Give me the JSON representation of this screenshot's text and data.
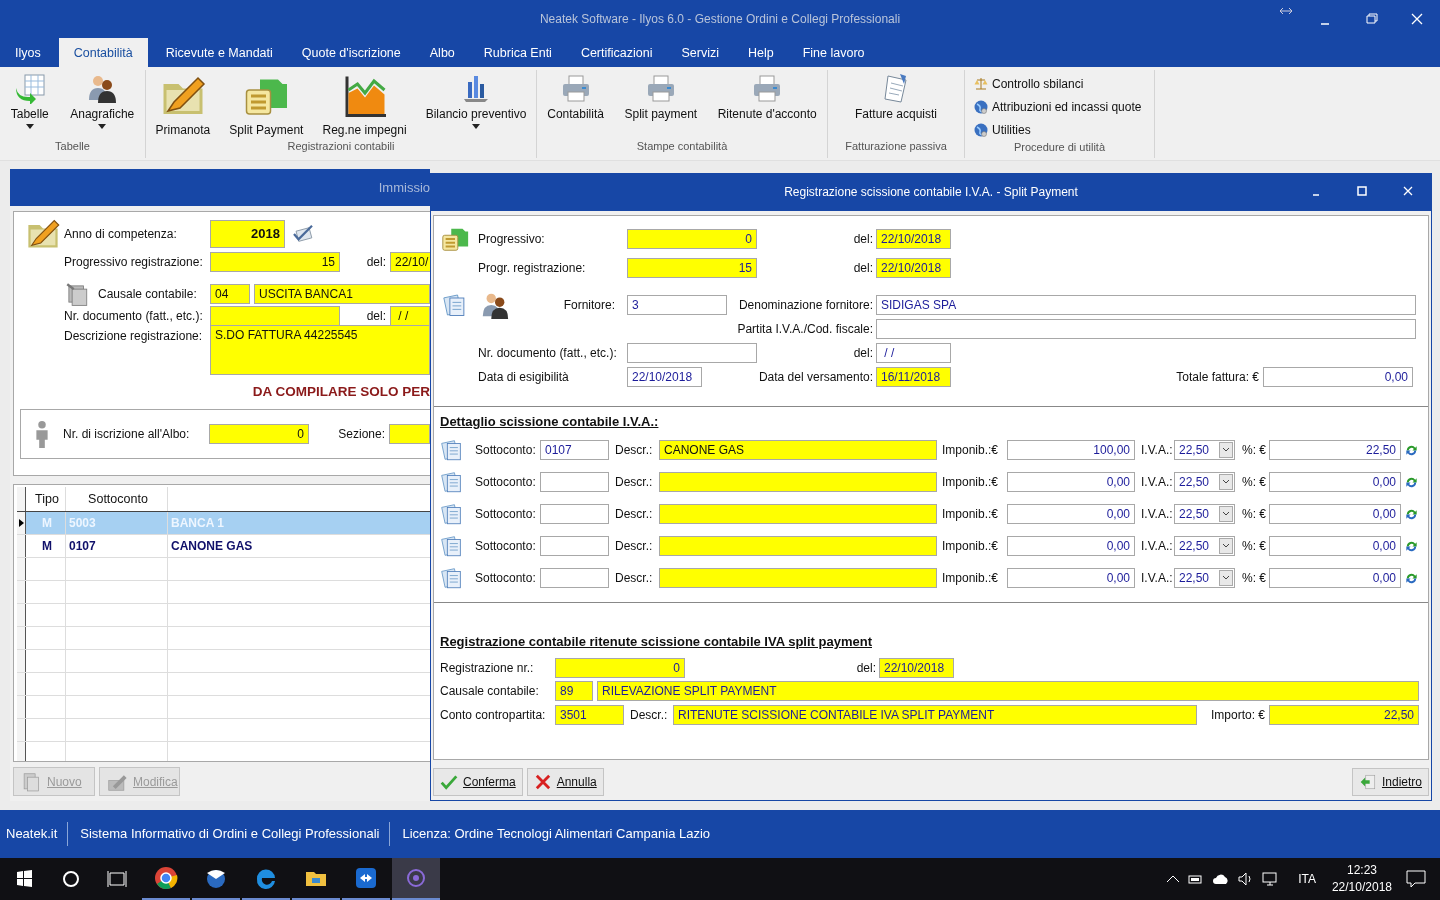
{
  "window": {
    "title": "Neatek Software - Ilyos 6.0 - Gestione Ordini e Collegi Professionali"
  },
  "menu_tabs": [
    {
      "label": "Ilyos",
      "selected": false
    },
    {
      "label": "Contabilità",
      "selected": true
    },
    {
      "label": "Ricevute e Mandati",
      "selected": false
    },
    {
      "label": "Quote d'iscrizione",
      "selected": false
    },
    {
      "label": "Albo",
      "selected": false
    },
    {
      "label": "Rubrica Enti",
      "selected": false
    },
    {
      "label": "Certificazioni",
      "selected": false
    },
    {
      "label": "Servizi",
      "selected": false
    },
    {
      "label": "Help",
      "selected": false
    },
    {
      "label": "Fine lavoro",
      "selected": false
    }
  ],
  "ribbon_groups": [
    {
      "label": "Tabelle",
      "items": [
        {
          "label": "Tabelle",
          "kind": "dropdown"
        },
        {
          "label": "Anagrafiche",
          "kind": "dropdown"
        }
      ]
    },
    {
      "label": "Registrazioni contabili",
      "items": [
        {
          "label": "Primanota",
          "kind": "large"
        },
        {
          "label": "Split Payment",
          "kind": "large"
        },
        {
          "label": "Reg.ne impegni",
          "kind": "large"
        },
        {
          "label": "Bilancio preventivo",
          "kind": "dropdown"
        }
      ]
    },
    {
      "label": "Stampe contabilità",
      "items": [
        {
          "label": "Contabilità",
          "kind": "large"
        },
        {
          "label": "Split payment",
          "kind": "large"
        },
        {
          "label": "Ritenute d'acconto",
          "kind": "large"
        }
      ]
    },
    {
      "label": "Fatturazione passiva",
      "items": [
        {
          "label": "Fatture acquisti",
          "kind": "large"
        }
      ]
    },
    {
      "label": "Procedure di utilità",
      "items": [
        {
          "label": "Controllo sbilanci",
          "kind": "small"
        },
        {
          "label": "Attribuzioni ed incassi quote",
          "kind": "small"
        },
        {
          "label": "Utilities",
          "kind": "small"
        }
      ]
    }
  ],
  "entry_window": {
    "title": "Immissio",
    "anno": {
      "label": "Anno di competenza:",
      "value": "2018"
    },
    "progressivo": {
      "label": "Progressivo registrazione:",
      "value": "15",
      "date_label": "del:",
      "date": "22/10/"
    },
    "causale": {
      "label": "Causale contabile:",
      "code": "04",
      "descr": "USCITA BANCA1"
    },
    "documento": {
      "label": "Nr. documento (fatt., etc.):",
      "date_label": "del:",
      "date": " / /"
    },
    "descrizione": {
      "label": "Descrizione registrazione:",
      "value": "S.DO FATTURA 44225545"
    },
    "notice": "DA COMPILARE SOLO PER",
    "albo": {
      "label": "Nr. di iscrizione all'Albo:",
      "value": "0",
      "section_label": "Sezione:"
    },
    "table": {
      "columns": [
        "Tipo",
        "Sottoconto"
      ],
      "rows": [
        {
          "tipo": "M",
          "sottoconto": "5003",
          "descrizione": "BANCA 1",
          "selected": true
        },
        {
          "tipo": "M",
          "sottoconto": "0107",
          "descrizione": "CANONE GAS",
          "selected": false
        }
      ]
    },
    "buttons": [
      {
        "label": "Nuovo",
        "disabled": true
      },
      {
        "label": "Modifica",
        "disabled": true
      }
    ]
  },
  "dialog": {
    "title": "Registrazione scissione contabile I.V.A. - Split Payment",
    "progressivo": {
      "label": "Progressivo:",
      "value": "0",
      "date_label": "del:",
      "date": "22/10/2018"
    },
    "progr_registrazione": {
      "label": "Progr. registrazione:",
      "value": "15",
      "date_label": "del:",
      "date": "22/10/2018"
    },
    "fornitore": {
      "label": "Fornitore:",
      "value": "3",
      "name_label": "Denominazione fornitore:",
      "name": "SIDIGAS SPA",
      "vat_label": "Partita I.V.A./Cod. fiscale:"
    },
    "documento": {
      "label": "Nr. documento (fatt., etc.):",
      "date_label": "del:",
      "date": " / /"
    },
    "esigibilita": {
      "label": "Data di esigibilità",
      "value": "22/10/2018",
      "payment_label": "Data del versamento:",
      "payment_date": "16/11/2018",
      "total_label": "Totale fattura: €",
      "total": "0,00"
    },
    "detail_heading": "Dettaglio scissione contabile I.V.A.:",
    "detail_rows": [
      {
        "account_label": "Sottoconto:",
        "account": "0107",
        "descr_label": "Descr.:",
        "descr": "CANONE GAS",
        "taxable_label": "Imponib.:€",
        "taxable": "100,00",
        "vat_label": "I.V.A.:",
        "vat_rate": "22,50",
        "pct_label": "%: €",
        "vat_amount": "22,50"
      },
      {
        "account_label": "Sottoconto:",
        "descr_label": "Descr.:",
        "taxable_label": "Imponib.:€",
        "taxable": "0,00",
        "vat_label": "I.V.A.:",
        "vat_rate": "22,50",
        "pct_label": "%: €",
        "vat_amount": "0,00"
      },
      {
        "account_label": "Sottoconto:",
        "descr_label": "Descr.:",
        "taxable_label": "Imponib.:€",
        "taxable": "0,00",
        "vat_label": "I.V.A.:",
        "vat_rate": "22,50",
        "pct_label": "%: €",
        "vat_amount": "0,00"
      },
      {
        "account_label": "Sottoconto:",
        "descr_label": "Descr.:",
        "taxable_label": "Imponib.:€",
        "taxable": "0,00",
        "vat_label": "I.V.A.:",
        "vat_rate": "22,50",
        "pct_label": "%: €",
        "vat_amount": "0,00"
      },
      {
        "account_label": "Sottoconto:",
        "descr_label": "Descr.:",
        "taxable_label": "Imponib.:€",
        "taxable": "0,00",
        "vat_label": "I.V.A.:",
        "vat_rate": "22,50",
        "pct_label": "%: €",
        "vat_amount": "0,00"
      }
    ],
    "ritenute": {
      "heading": "Registrazione contabile ritenute scissione contabile IVA split payment",
      "reg_label": "Registrazione nr.:",
      "reg": "0",
      "date_label": "del:",
      "date": "22/10/2018",
      "causale_label": "Causale contabile:",
      "causale_code": "89",
      "causale": "RILEVAZIONE SPLIT PAYMENT",
      "conto_label": "Conto contropartita:",
      "conto": "3501",
      "descr_label": "Descr.:",
      "descr": "RITENUTE SCISSIONE CONTABILE IVA SPLIT PAYMENT",
      "importo_label": "Importo: €",
      "importo": "22,50"
    },
    "buttons": [
      {
        "label": "Conferma",
        "kind": "confirm"
      },
      {
        "label": "Annulla",
        "kind": "cancel"
      },
      {
        "label": "Indietro",
        "kind": "back"
      }
    ]
  },
  "status_bar": [
    "Neatek.it",
    "Sistema Informativo di Ordini e Collegi Professionali",
    "Licenza: Ordine Tecnologi Alimentari Campania Lazio"
  ],
  "taskbar": {
    "apps": [
      {
        "selected": false
      },
      {
        "selected": false
      },
      {
        "selected": false
      },
      {
        "selected": false
      },
      {
        "selected": false
      },
      {
        "selected": true
      }
    ],
    "language": "ITA",
    "time": "12:23",
    "date": "22/10/2018"
  }
}
